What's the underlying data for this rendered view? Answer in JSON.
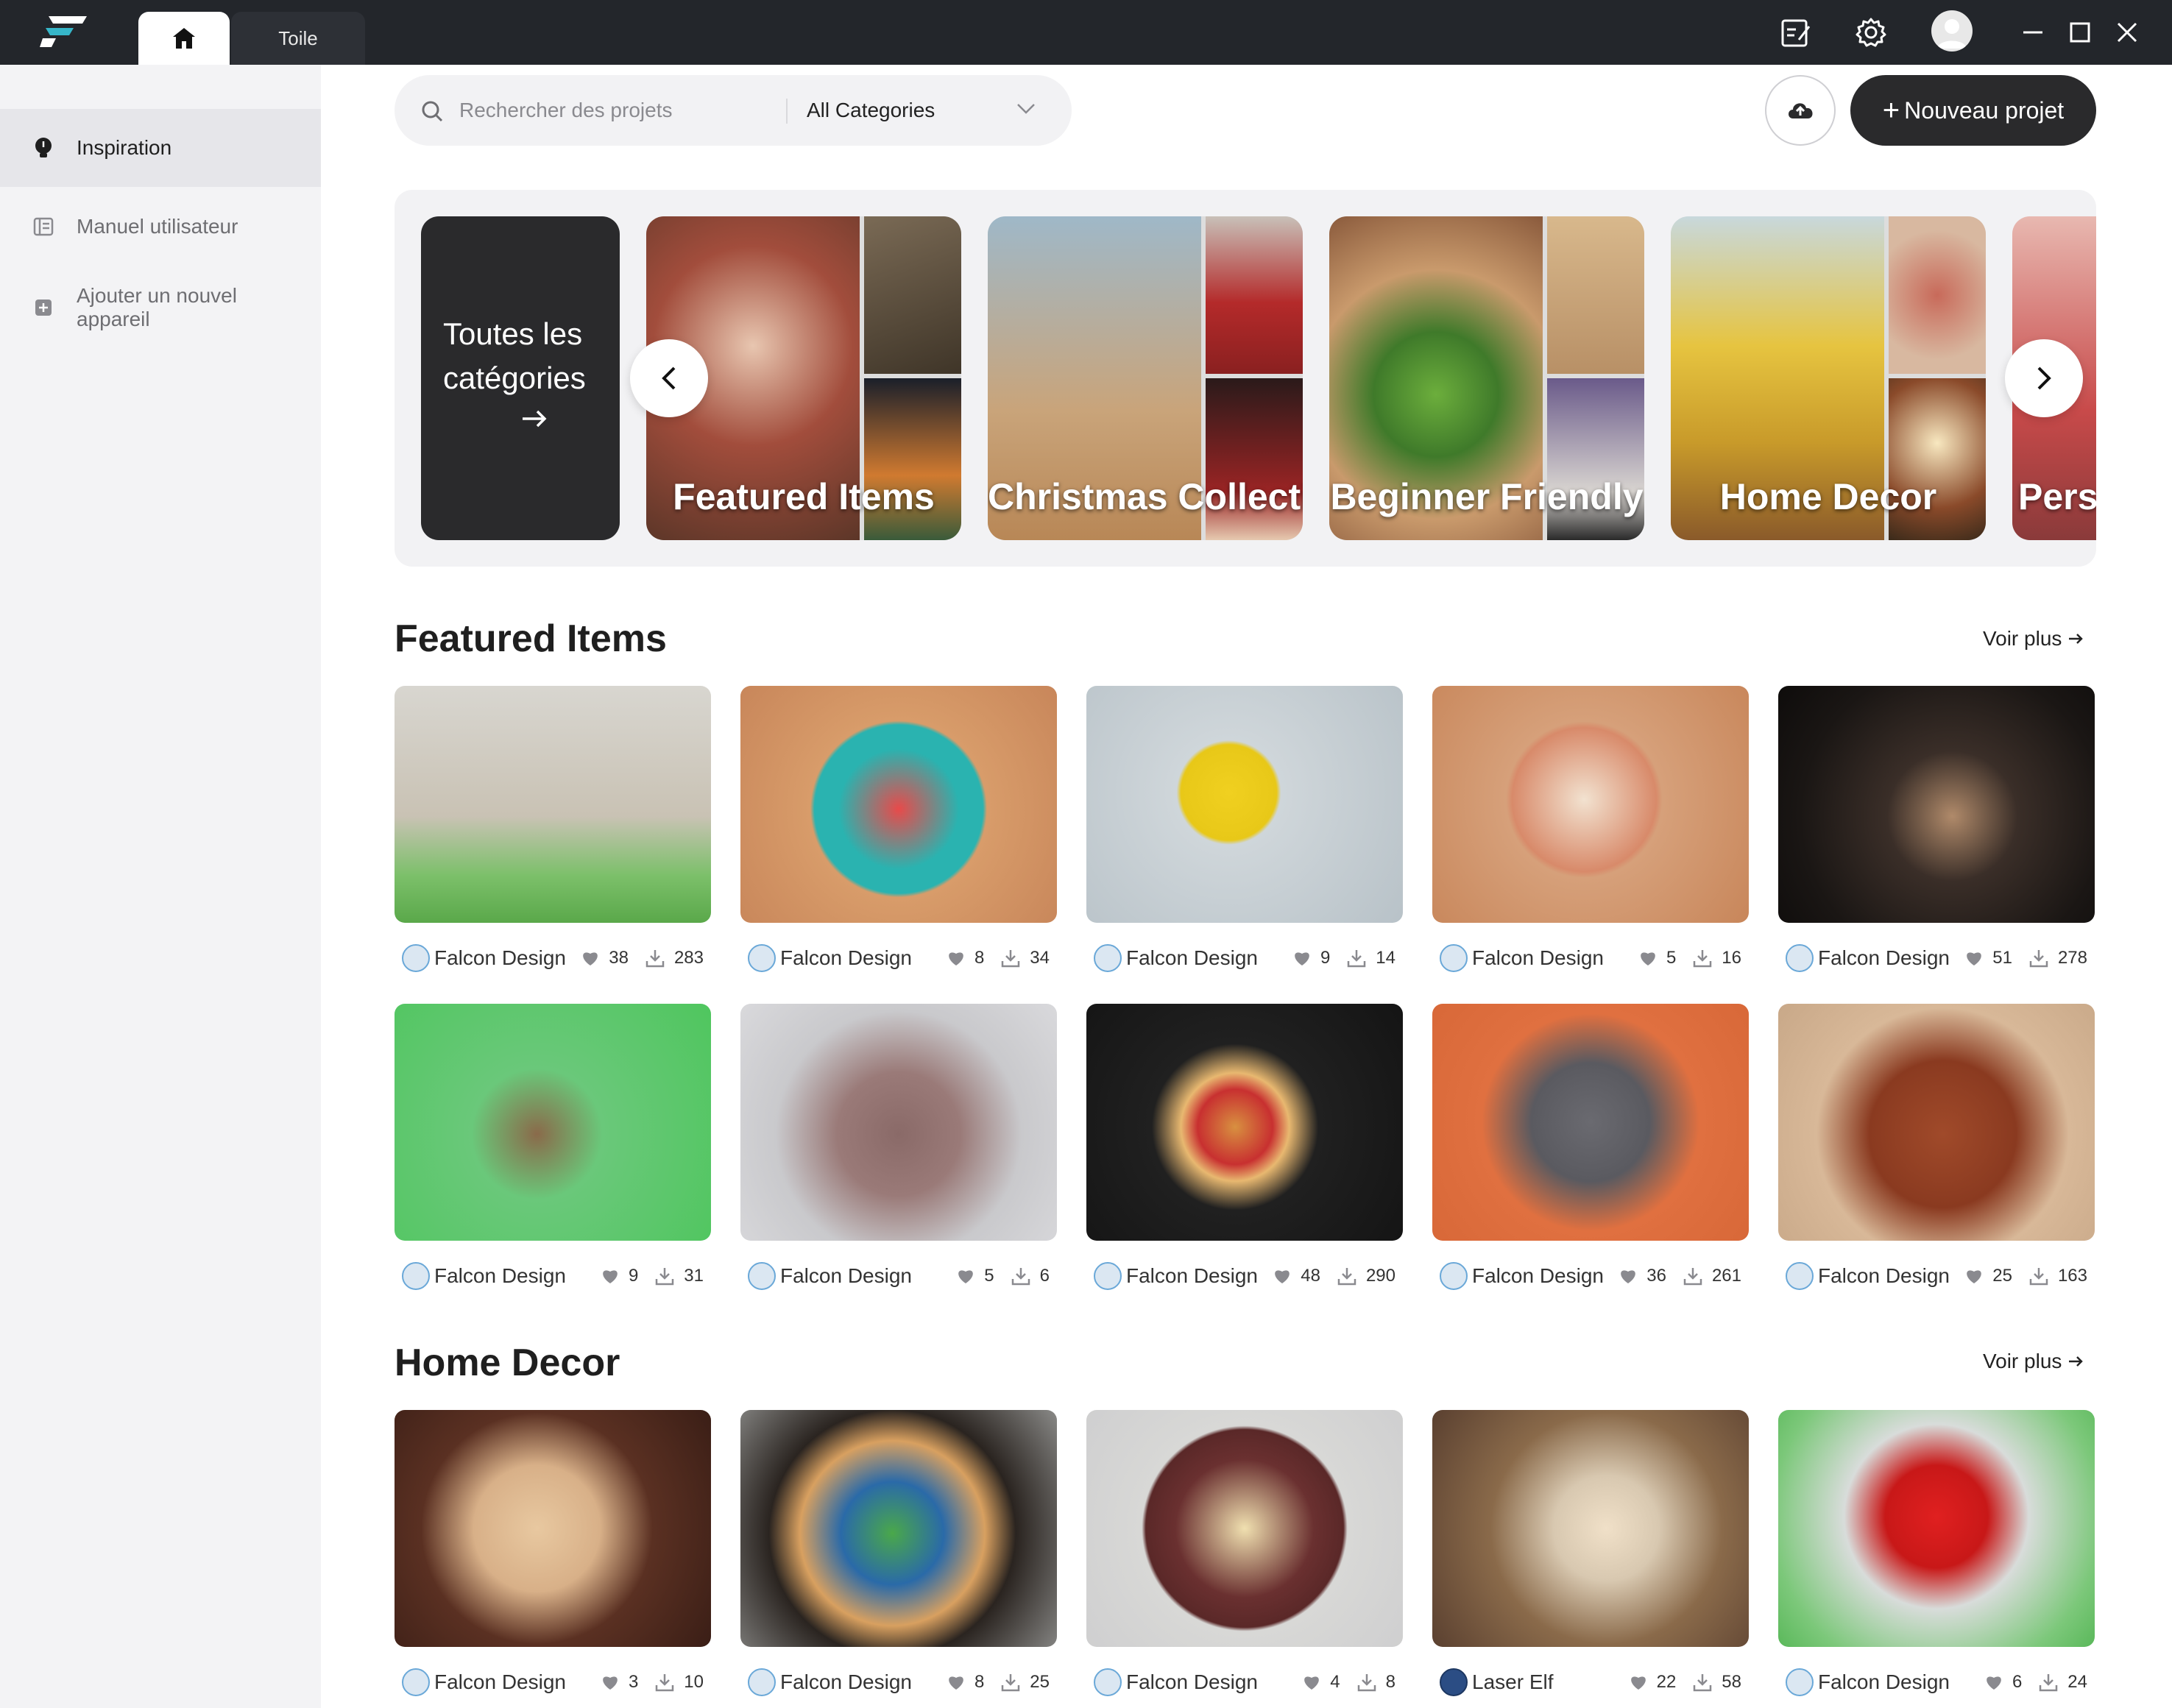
{
  "titlebar": {
    "tab_canvas": "Toile",
    "colors": {
      "bar": "#23262b",
      "accent": "#36b6c9"
    }
  },
  "sidebar": {
    "items": [
      {
        "label": "Inspiration",
        "icon": "lightbulb-icon",
        "active": true
      },
      {
        "label": "Manuel utilisateur",
        "icon": "manual-icon",
        "active": false
      },
      {
        "label": "Ajouter un nouvel appareil",
        "icon": "add-device-icon",
        "active": false
      }
    ]
  },
  "search": {
    "placeholder": "Rechercher des projets",
    "category_value": "All Categories"
  },
  "actions": {
    "new_project_label": "Nouveau projet"
  },
  "carousel": {
    "all_categories_label": "Toutes les catégories",
    "cards": [
      {
        "label": "Featured Items"
      },
      {
        "label": "Christmas Collection"
      },
      {
        "label": "Beginner Friendly"
      },
      {
        "label": "Home Decor"
      },
      {
        "label": "Personalized"
      }
    ]
  },
  "sections": [
    {
      "title": "Featured Items",
      "see_more": "Voir plus",
      "items": [
        {
          "author": "Falcon Design",
          "likes": "38",
          "downloads": "283",
          "image": "wooden-merry-christmas-tree-sign"
        },
        {
          "author": "Falcon Design",
          "likes": "8",
          "downloads": "34",
          "image": "santa-round-ornament"
        },
        {
          "author": "Falcon Design",
          "likes": "9",
          "downloads": "14",
          "image": "yellow-acrylic-deer-head"
        },
        {
          "author": "Falcon Design",
          "likes": "5",
          "downloads": "16",
          "image": "string-art-christmas-tree"
        },
        {
          "author": "Falcon Design",
          "likes": "51",
          "downloads": "278",
          "image": "wooden-reindeer"
        },
        {
          "author": "Falcon Design",
          "likes": "9",
          "downloads": "31",
          "image": "spiral-wooden-tree"
        },
        {
          "author": "Falcon Design",
          "likes": "5",
          "downloads": "6",
          "image": "engraved-tote-bag"
        },
        {
          "author": "Falcon Design",
          "likes": "48",
          "downloads": "290",
          "image": "jingle-butts-ornament"
        },
        {
          "author": "Falcon Design",
          "likes": "36",
          "downloads": "261",
          "image": "slate-coasters"
        },
        {
          "author": "Falcon Design",
          "likes": "25",
          "downloads": "163",
          "image": "merry-christmas-cutting-board"
        }
      ]
    },
    {
      "title": "Home Decor",
      "see_more": "Voir plus",
      "items": [
        {
          "author": "Falcon Design",
          "likes": "3",
          "downloads": "10",
          "image": "compass-cutting-board"
        },
        {
          "author": "Falcon Design",
          "likes": "8",
          "downloads": "25",
          "image": "layered-bear-frame"
        },
        {
          "author": "Falcon Design",
          "likes": "4",
          "downloads": "8",
          "image": "mountain-wall-clock"
        },
        {
          "author": "Laser Elf",
          "likes": "22",
          "downloads": "58",
          "image": "family-name-tree-ornament"
        },
        {
          "author": "Falcon Design",
          "likes": "6",
          "downloads": "24",
          "image": "red-snowflake-ornament"
        }
      ]
    }
  ]
}
